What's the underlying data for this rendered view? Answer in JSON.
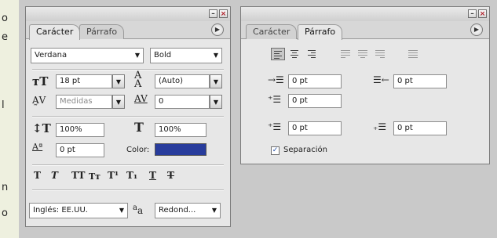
{
  "background_text": [
    "o",
    "e",
    "l",
    "n",
    "o"
  ],
  "character_panel": {
    "tabs": [
      "Carácter",
      "Párrafo"
    ],
    "font_family": "Verdana",
    "font_style": "Bold",
    "font_size": "18 pt",
    "leading": "(Auto)",
    "kerning": "Medidas",
    "tracking": "0",
    "vertical_scale": "100%",
    "horizontal_scale": "100%",
    "baseline_shift": "0 pt",
    "color_label": "Color:",
    "color_value": "#283c9c",
    "language": "Inglés: EE.UU.",
    "antialias": "Redond...",
    "antialias_icon_text": "a",
    "antialias_icon_sub": "a"
  },
  "paragraph_panel": {
    "tabs": [
      "Carácter",
      "Párrafo"
    ],
    "indent_left": "0 pt",
    "indent_right": "0 pt",
    "indent_first_line": "0 pt",
    "space_before": "0 pt",
    "space_after": "0 pt",
    "hyphenate_label": "Separación",
    "hyphenate_checked": true
  },
  "icons": {
    "minimize": "minimize-icon",
    "close": "close-icon",
    "flyout": "panel-menu-icon"
  }
}
